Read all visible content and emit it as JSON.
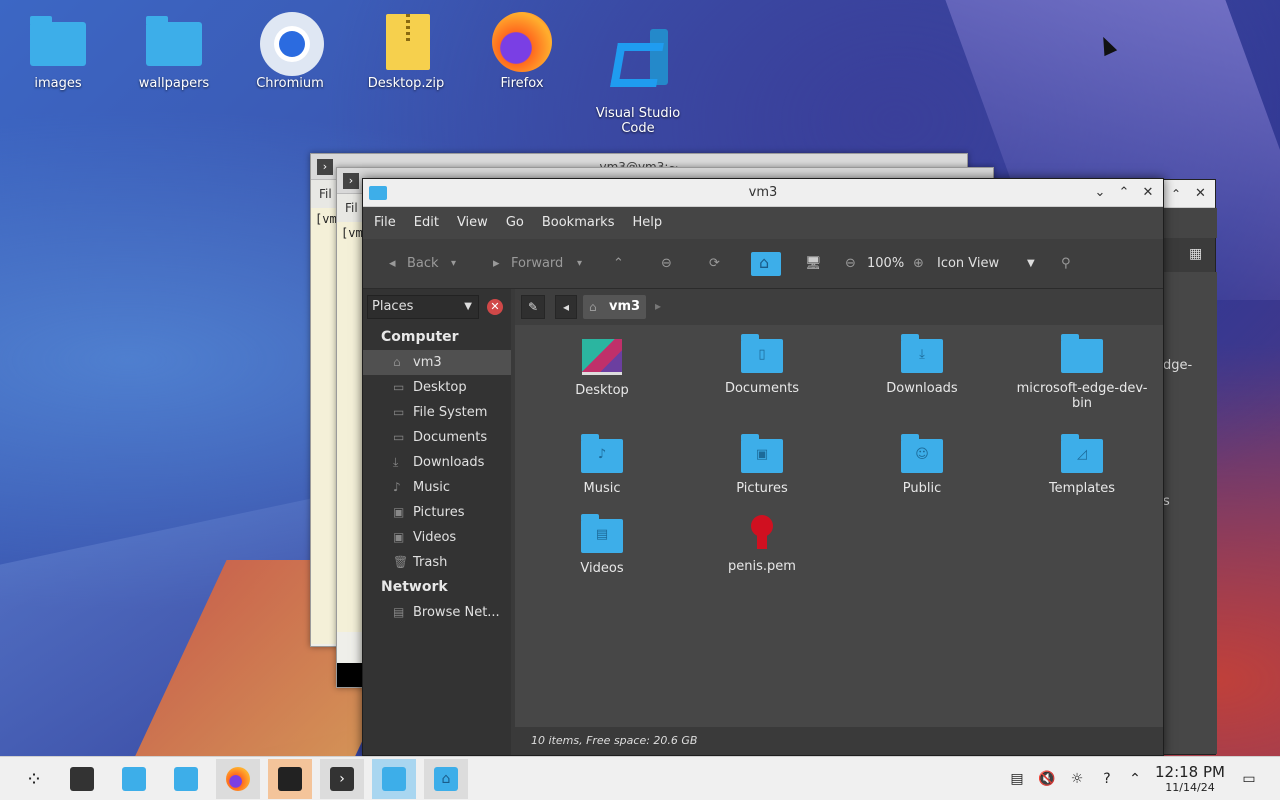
{
  "desktop": {
    "icons": [
      {
        "label": "images",
        "icon": "folder-icon"
      },
      {
        "label": "wallpapers",
        "icon": "folder-icon"
      },
      {
        "label": "Chromium",
        "icon": "chromium-icon"
      },
      {
        "label": "Desktop.zip",
        "icon": "zip-icon"
      },
      {
        "label": "Firefox",
        "icon": "firefox-icon"
      },
      {
        "label": "Visual Studio\nCode",
        "icon": "vscode-icon"
      }
    ]
  },
  "bg_windows": {
    "term1_title": "vm3@vm3:~",
    "term1_menu": "Fil",
    "term1_prompt": "[vm",
    "term2_menu": "Fil",
    "term2_prompt": "[vm"
  },
  "file_manager": {
    "title": "vm3",
    "menu": [
      "File",
      "Edit",
      "View",
      "Go",
      "Bookmarks",
      "Help"
    ],
    "toolbar": {
      "back": "Back",
      "forward": "Forward",
      "zoom": "100%",
      "view_mode": "Icon View"
    },
    "places_label": "Places",
    "sidebar": {
      "computer_heading": "Computer",
      "computer_items": [
        "vm3",
        "Desktop",
        "File System",
        "Documents",
        "Downloads",
        "Music",
        "Pictures",
        "Videos",
        "Trash"
      ],
      "network_heading": "Network",
      "network_items": [
        "Browse Net..."
      ]
    },
    "path": {
      "current": "vm3"
    },
    "items": [
      {
        "label": "Desktop",
        "icon": "desktop-folder-icon"
      },
      {
        "label": "Documents",
        "icon": "documents-folder-icon"
      },
      {
        "label": "Downloads",
        "icon": "downloads-folder-icon"
      },
      {
        "label": "microsoft-edge-dev-bin",
        "icon": "folder-icon"
      },
      {
        "label": "Music",
        "icon": "music-folder-icon"
      },
      {
        "label": "Pictures",
        "icon": "pictures-folder-icon"
      },
      {
        "label": "Public",
        "icon": "public-folder-icon"
      },
      {
        "label": "Templates",
        "icon": "templates-folder-icon"
      },
      {
        "label": "Videos",
        "icon": "videos-folder-icon"
      },
      {
        "label": "penis.pem",
        "icon": "certificate-icon"
      }
    ],
    "status": "10 items, Free space: 20.6 GB"
  },
  "bg_window_right": {
    "item1": "dge-",
    "item2": "s"
  },
  "taskbar": {
    "clock_time": "12:18 PM",
    "clock_date": "11/14/24"
  },
  "colors": {
    "accent": "#3daee9",
    "fm_bg": "#474747",
    "taskbar_bg": "#f0f0f0"
  }
}
